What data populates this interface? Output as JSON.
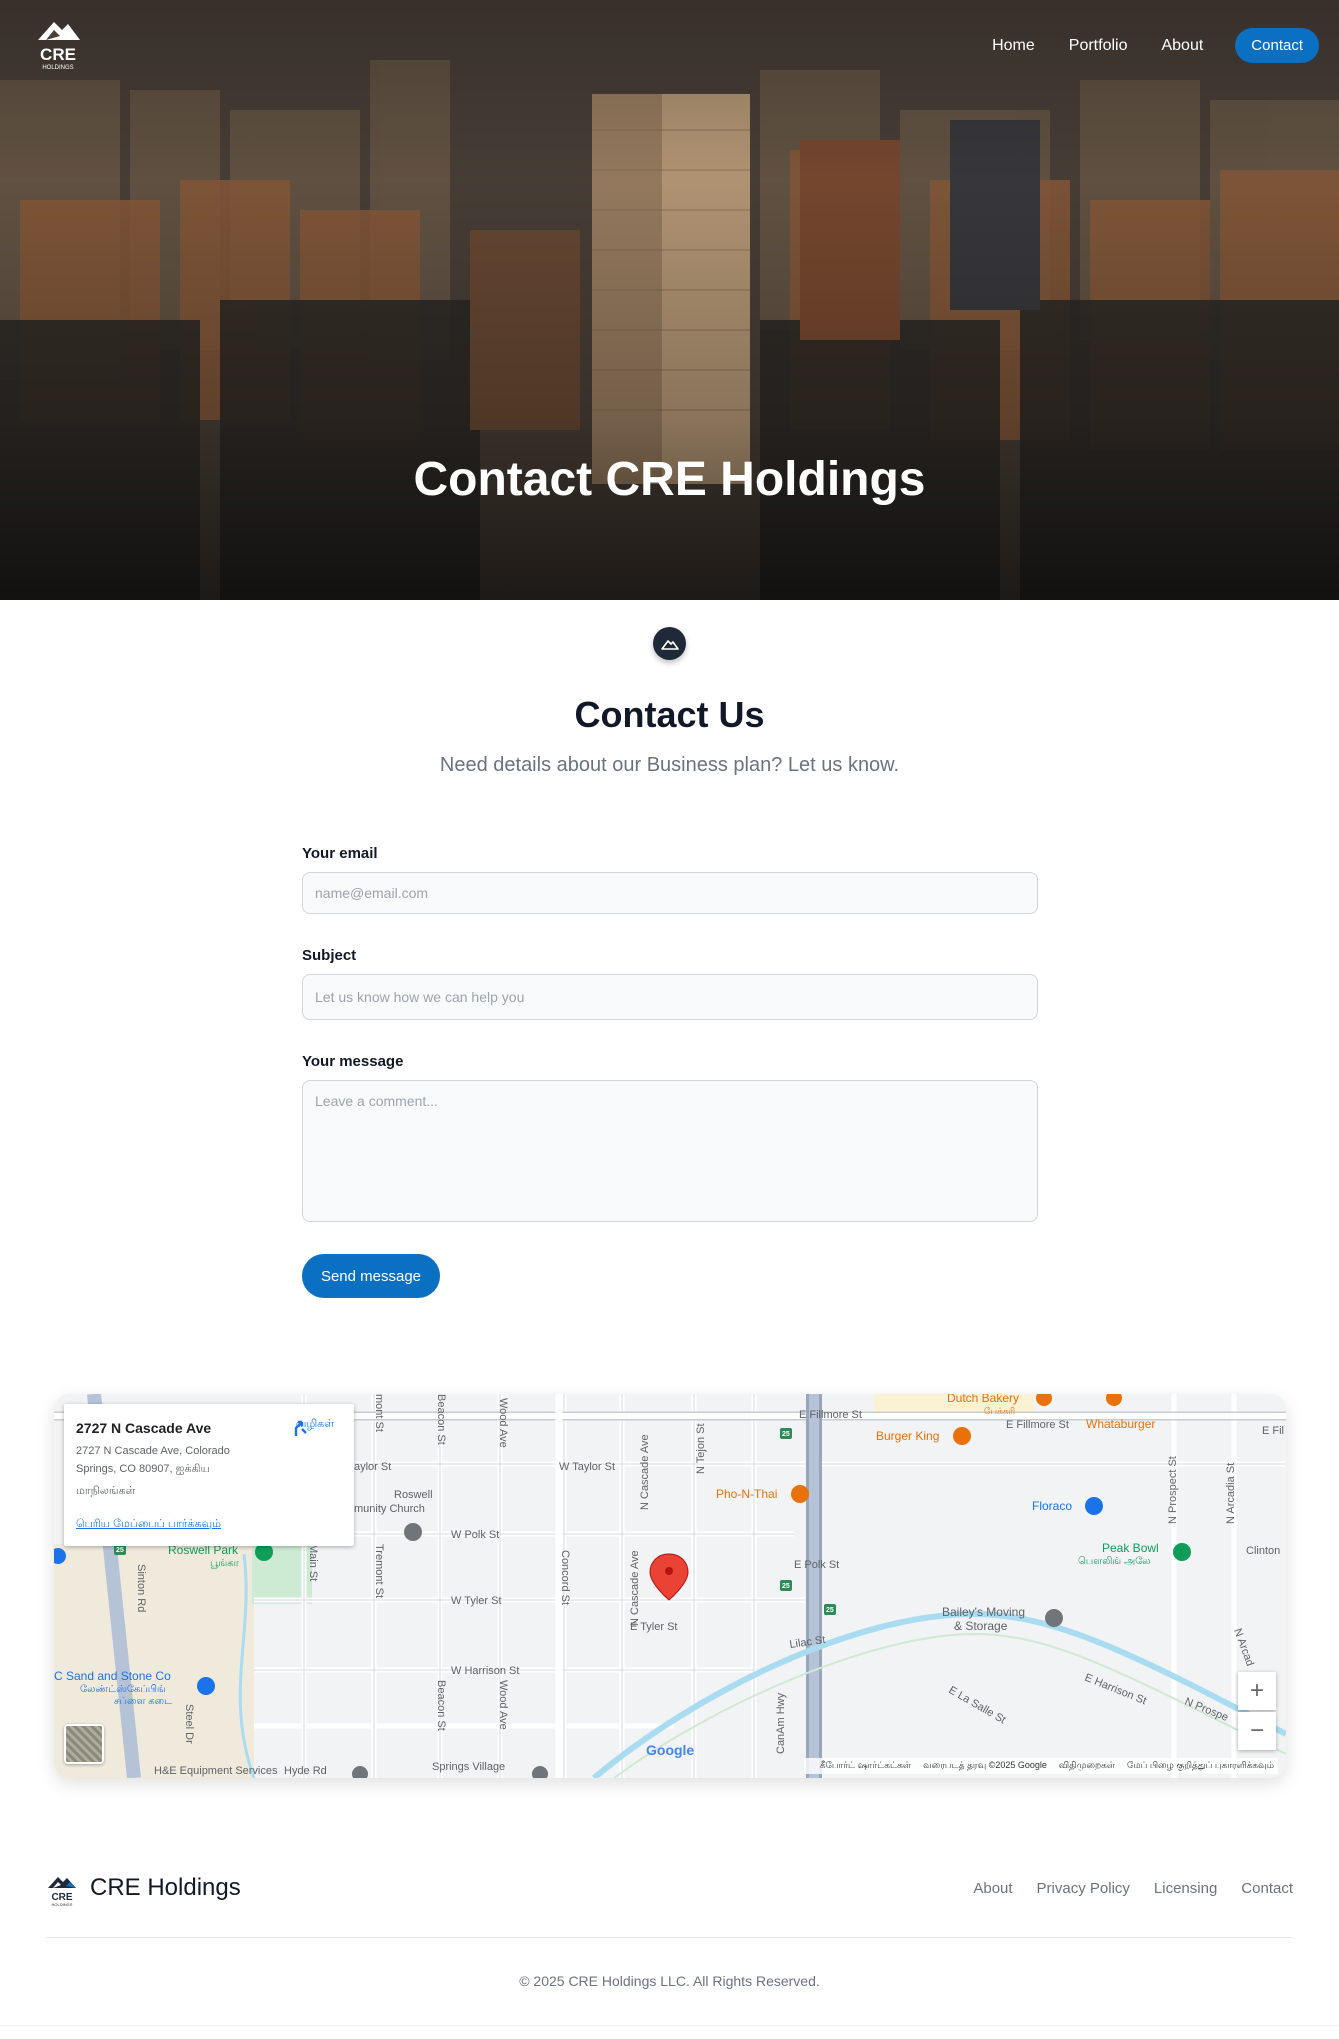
{
  "header": {
    "logo_text": "CRE",
    "logo_sub": "HOLDINGS",
    "nav": [
      {
        "label": "Home"
      },
      {
        "label": "Portfolio"
      },
      {
        "label": "About"
      }
    ],
    "contact_label": "Contact"
  },
  "hero": {
    "title": "Contact CRE Holdings"
  },
  "contact": {
    "title": "Contact Us",
    "subtitle": "Need details about our Business plan? Let us know.",
    "email_label": "Your email",
    "email_placeholder": "name@email.com",
    "subject_label": "Subject",
    "subject_placeholder": "Let us know how we can help you",
    "message_label": "Your message",
    "message_placeholder": "Leave a comment...",
    "send_label": "Send message"
  },
  "map": {
    "card": {
      "title": "2727 N Cascade Ave",
      "line1": "2727 N Cascade Ave, Colorado",
      "line2": "Springs, CO 80907, ஐக்கிய",
      "line3": "மாநிலங்கள்",
      "directions": "வழிகள்",
      "larger_map": "பெரிய மேப்பைப் பார்க்கவும்"
    },
    "labels": {
      "dutch_bakery": "Dutch Bakery",
      "dutch_bakery_ta": "பேக்கரி",
      "whataburger": "Whataburger",
      "burger_king": "Burger King",
      "e_fillmore_1": "E Fillmore St",
      "e_fillmore_2": "E Fillmore St",
      "e_fil": "E Fil",
      "pho_n_thai": "Pho-N-Thai",
      "floraco": "Floraco",
      "peak_bowl": "Peak Bowl",
      "peak_bowl_ta": "பௌலிங் அலே",
      "clinton": "Clinton",
      "baileys_1": "Bailey's Moving",
      "baileys_2": "& Storage",
      "w_taylor": "W Taylor St",
      "taylor_st": "aylor St",
      "roswell": "Roswell",
      "church": "munity Church",
      "w_polk": "W Polk St",
      "e_polk": "E Polk St",
      "w_tyler": "W Tyler St",
      "e_tyler": "E Tyler St",
      "lilac": "Lilac St",
      "w_harrison": "W Harrison St",
      "e_harrison": "E Harrison St",
      "la_salle": "E La Salle St",
      "n_prospe": "N Prospe",
      "roswell_park": "Roswell Park",
      "roswell_park_ta": "பூங்கா",
      "sand_stone": "C Sand and Stone Co",
      "sand_stone_ta_1": "லேண்ட்ஸ்கேப்பிங்",
      "sand_stone_ta_2": "சப்ளை கடை",
      "springs_village": "Springs Village",
      "equipment": "H&E Equipment Services",
      "hyde": "Hyde Rd",
      "sinton": "Sinton Rd",
      "steel": "Steel Dr",
      "main_st": "Main St",
      "tremont": "Tremont St",
      "tremont_top": "mont St",
      "beacon_top": "Beacon St",
      "beacon_bottom": "Beacon St",
      "wood_top": "Wood Ave",
      "wood_bottom": "Wood Ave",
      "concord": "Concord St",
      "n_cascade_top": "N Cascade Ave",
      "n_cascade_mid": "N Cascade Ave",
      "n_tejon": "N Tejon St",
      "canam": "CanAm Hwy",
      "n_prospect": "N Prospect St",
      "n_arcadia": "N Arcadia St",
      "n_arcad": "N Arcad",
      "i25_a": "25",
      "i25_b": "25",
      "i25_c": "25",
      "i25_d": "25"
    },
    "zoom_in": "+",
    "zoom_out": "−",
    "google": "Google",
    "attribution": {
      "shortcuts": "கீபோர்ட் ஷார்ட்கட்கள்",
      "mapdata": "வரைபடத் தரவு ©2025 Google",
      "terms": "விதிமுறைகள்",
      "report": "மேப் பிழை குறித்துப் புகாரளிக்கவும்"
    }
  },
  "footer": {
    "brand": "CRE Holdings",
    "links": [
      {
        "label": "About"
      },
      {
        "label": "Privacy Policy"
      },
      {
        "label": "Licensing"
      },
      {
        "label": "Contact"
      }
    ],
    "copyright": "© 2025 CRE Holdings LLC. All Rights Reserved."
  },
  "colors": {
    "accent": "#0b6fc2",
    "dark": "#1f2937",
    "muted": "#6b7280",
    "map_pin": "#ea4335",
    "poi_orange": "#e8710a",
    "poi_blue": "#1a73e8",
    "poi_green": "#0f9d58"
  }
}
